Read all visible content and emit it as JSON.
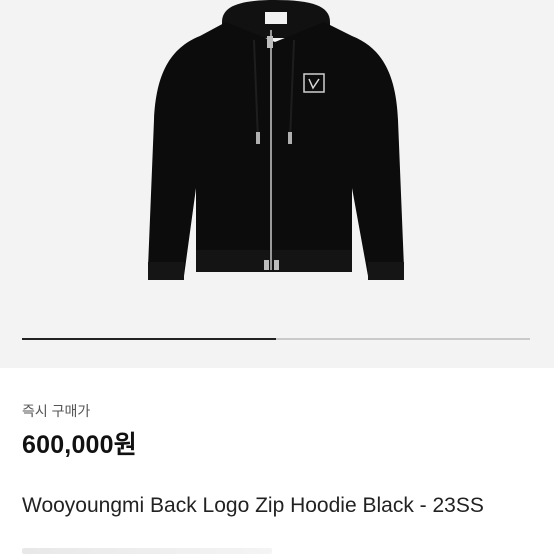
{
  "gallery": {
    "image_alt": "Black zip hoodie",
    "slider_progress": 0.5
  },
  "purchase": {
    "label": "즉시 구매가",
    "price": "600,000원"
  },
  "product": {
    "title": "Wooyoungmi Back Logo Zip Hoodie Black - 23SS"
  },
  "colors": {
    "background": "#f3f3f3",
    "garment": "#0c0c0c",
    "zipper": "#9a9a9a"
  }
}
